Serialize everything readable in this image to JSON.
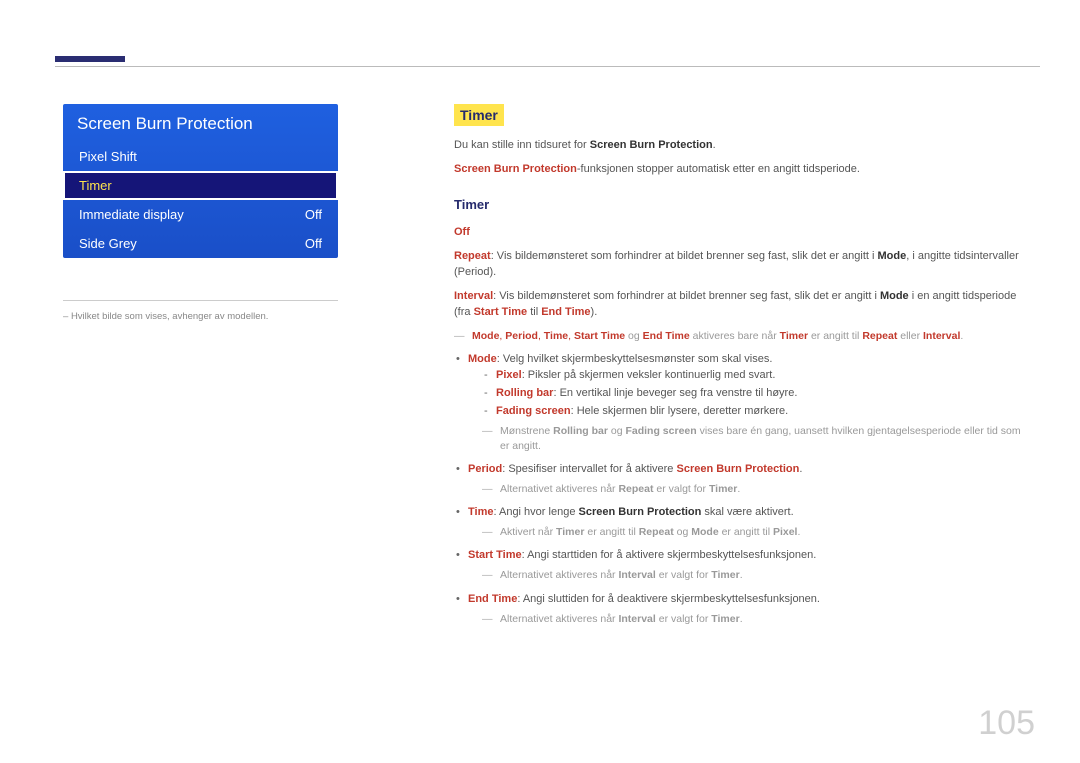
{
  "page_number": "105",
  "menu": {
    "title": "Screen Burn Protection",
    "items": [
      {
        "label": "Pixel Shift",
        "value": "",
        "selected": false
      },
      {
        "label": "Timer",
        "value": "",
        "selected": true
      },
      {
        "label": "Immediate display",
        "value": "Off",
        "selected": false
      },
      {
        "label": "Side Grey",
        "value": "Off",
        "selected": false
      }
    ]
  },
  "footnote": "Hvilket bilde som vises, avhenger av modellen.",
  "heading_main": "Timer",
  "intro1_a": "Du kan stille inn tidsuret for ",
  "intro1_b": "Screen Burn Protection",
  "intro1_c": ".",
  "intro2_a": "Screen Burn Protection",
  "intro2_b": "-funksjonen stopper automatisk etter en angitt tidsperiode.",
  "heading_sub": "Timer",
  "off_label": "Off",
  "repeat": {
    "k": "Repeat",
    "t1": ": Vis bildemønsteret som forhindrer at bildet brenner seg fast, slik det er angitt i ",
    "m": "Mode",
    "t2": ", i angitte tidsintervaller (Period)."
  },
  "interval": {
    "k": "Interval",
    "t1": ": Vis bildemønsteret som forhindrer at bildet brenner seg fast, slik det er angitt i ",
    "m": "Mode",
    "t2": " i en angitt tidsperiode (fra ",
    "st": "Start Time",
    "t3": " til ",
    "et": "End Time",
    "t4": ")."
  },
  "note1": {
    "p1": "Mode",
    "c1": ", ",
    "p2": "Period",
    "c2": ", ",
    "p3": "Time",
    "c3": ", ",
    "p4": "Start Time",
    "c4": " og ",
    "p5": "End Time",
    "t1": " aktiveres bare når ",
    "p6": "Timer",
    "t2": " er angitt til ",
    "p7": "Repeat",
    "t3": " eller ",
    "p8": "Interval",
    "t4": "."
  },
  "mode_line": {
    "k": "Mode",
    "t": ": Velg hvilket skjermbeskyttelsesmønster som skal vises."
  },
  "pixel_line": {
    "k": "Pixel",
    "t": ": Piksler på skjermen veksler kontinuerlig med svart."
  },
  "rolling_line": {
    "k": "Rolling bar",
    "t": ": En vertikal linje beveger seg fra venstre til høyre."
  },
  "fading_line": {
    "k": "Fading screen",
    "t": ": Hele skjermen blir lysere, deretter mørkere."
  },
  "note2": {
    "t1": "Mønstrene ",
    "p1": "Rolling bar",
    "t2": " og ",
    "p2": "Fading screen",
    "t3": " vises bare én gang, uansett hvilken gjentagelsesperiode eller tid som er angitt."
  },
  "period_line": {
    "k": "Period",
    "t1": ": Spesifiser intervallet for å aktivere ",
    "sb": "Screen Burn Protection",
    "t2": "."
  },
  "note3": {
    "t1": "Alternativet aktiveres når ",
    "p1": "Repeat",
    "t2": " er valgt for ",
    "p2": "Timer",
    "t3": "."
  },
  "time_line": {
    "k": "Time",
    "t1": ": Angi hvor lenge ",
    "sb": "Screen Burn Protection",
    "t2": " skal være aktivert."
  },
  "note4": {
    "t1": "Aktivert når ",
    "p1": "Timer",
    "t2": " er angitt til ",
    "p2": "Repeat",
    "t3": " og ",
    "p3": "Mode",
    "t4": " er angitt til ",
    "p4": "Pixel",
    "t5": "."
  },
  "start_line": {
    "k": "Start Time",
    "t": ": Angi starttiden for å aktivere skjermbeskyttelsesfunksjonen."
  },
  "note5": {
    "t1": "Alternativet aktiveres når ",
    "p1": "Interval",
    "t2": " er valgt for ",
    "p2": "Timer",
    "t3": "."
  },
  "end_line": {
    "k": "End Time",
    "t": ": Angi sluttiden for å deaktivere skjermbeskyttelsesfunksjonen."
  },
  "note6": {
    "t1": "Alternativet aktiveres når ",
    "p1": "Interval",
    "t2": " er valgt for ",
    "p2": "Timer",
    "t3": "."
  }
}
